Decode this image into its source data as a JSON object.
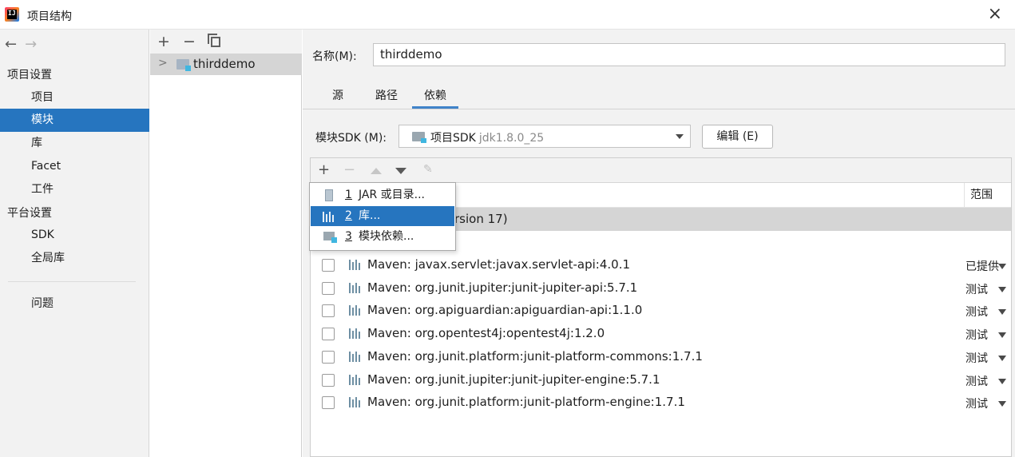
{
  "window": {
    "title": "项目结构",
    "close_icon": "×"
  },
  "nav": {
    "back_arrow": "←",
    "forward_arrow": "→",
    "project_settings": "项目设置",
    "items_project": [
      {
        "label": "项目",
        "selected": false
      },
      {
        "label": "模块",
        "selected": true
      },
      {
        "label": "库",
        "selected": false
      },
      {
        "label": "Facet",
        "selected": false
      },
      {
        "label": "工件",
        "selected": false
      }
    ],
    "platform_settings": "平台设置",
    "items_platform": [
      {
        "label": "SDK"
      },
      {
        "label": "全局库"
      }
    ],
    "problems": "问题"
  },
  "module_tree": {
    "add": "+",
    "remove": "−",
    "module_name": "thirddemo"
  },
  "module_detail": {
    "name_label": "名称(M):",
    "name_value": "thirddemo",
    "tabs": [
      "源",
      "路径",
      "依赖"
    ],
    "active_tab": "依赖",
    "sdk_label": "模块SDK (M):",
    "sdk_value": "项目SDK",
    "sdk_version": "jdk1.8.0_25",
    "edit_button": "编辑 (E)"
  },
  "dependencies": {
    "toolbar": {
      "add": "+",
      "remove": "−"
    },
    "scope_header": "范围",
    "sdk_row_text": "rsion 17)",
    "rows": [
      {
        "name": "Maven: javax.servlet:javax.servlet-api:4.0.1",
        "scope": "已提供"
      },
      {
        "name": "Maven: org.junit.jupiter:junit-jupiter-api:5.7.1",
        "scope": "测试"
      },
      {
        "name": "Maven: org.apiguardian:apiguardian-api:1.1.0",
        "scope": "测试"
      },
      {
        "name": "Maven: org.opentest4j:opentest4j:1.2.0",
        "scope": "测试"
      },
      {
        "name": "Maven: org.junit.platform:junit-platform-commons:1.7.1",
        "scope": "测试"
      },
      {
        "name": "Maven: org.junit.jupiter:junit-jupiter-engine:5.7.1",
        "scope": "测试"
      },
      {
        "name": "Maven: org.junit.platform:junit-platform-engine:1.7.1",
        "scope": "测试"
      }
    ]
  },
  "add_popup": {
    "items": [
      {
        "num": "1",
        "label": "JAR 或目录...",
        "icon": "jar-icon",
        "selected": false
      },
      {
        "num": "2",
        "label": "库...",
        "icon": "library-icon",
        "selected": true
      },
      {
        "num": "3",
        "label": "模块依赖...",
        "icon": "module-icon",
        "selected": false
      }
    ]
  },
  "colors": {
    "selection": "#2675bf",
    "panel_bg": "#f2f2f2",
    "row_highlight": "#d5d5d5"
  }
}
